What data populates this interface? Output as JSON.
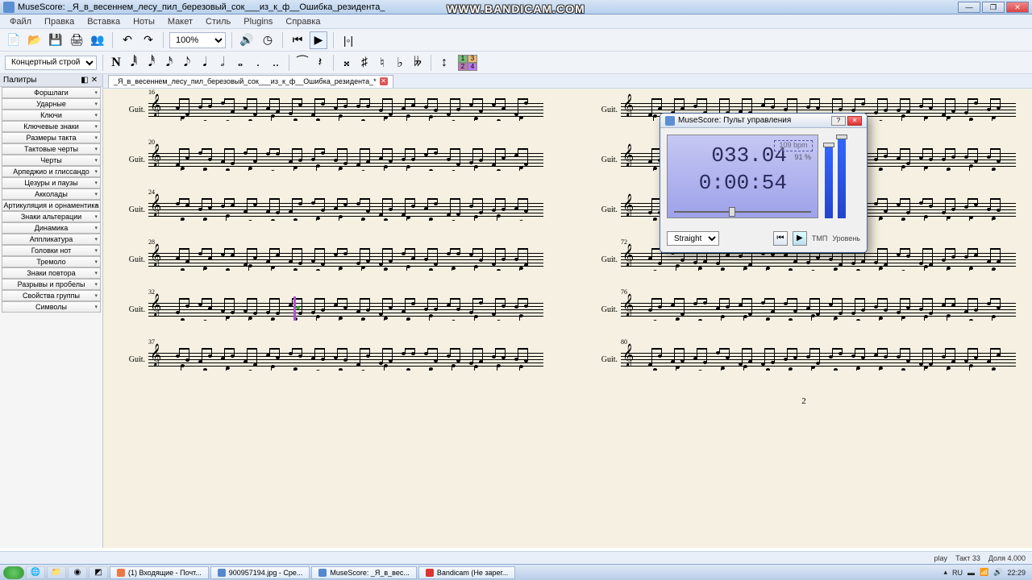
{
  "title_bar": {
    "app": "MuseScore",
    "doc": "_Я_в_весеннем_лесу_пил_березовый_сок___из_к_ф__Ошибка_резидента_"
  },
  "watermark": "WWW.BANDICAM.COM",
  "menu": [
    "Файл",
    "Правка",
    "Вставка",
    "Ноты",
    "Макет",
    "Стиль",
    "Plugins",
    "Справка"
  ],
  "zoom": "100%",
  "layout_selector": "Концертный строй",
  "voice_labels": [
    "1",
    "2",
    "3",
    "4"
  ],
  "palette": {
    "title": "Палитры",
    "items": [
      "Форшлаги",
      "Ударные",
      "Ключи",
      "Ключевые знаки",
      "Размеры такта",
      "Тактовые черты",
      "Черты",
      "Арпеджио и глиссандо",
      "Цезуры и паузы",
      "Акколады",
      "Артикуляция и орнаментика",
      "Знаки альтерации",
      "Динамика",
      "Аппликатура",
      "Головки нот",
      "Тремоло",
      "Знаки повтора",
      "Разрывы и пробелы",
      "Свойства группы",
      "Символы"
    ]
  },
  "tab": {
    "label": "_Я_в_весеннем_лесу_пил_березовый_сок___из_к_ф__Ошибка_резидента_*"
  },
  "score": {
    "instrument": "Guit.",
    "left_measures": [
      "16",
      "20",
      "24",
      "28",
      "32",
      "37"
    ],
    "right_measures": [
      "",
      "",
      "",
      "72",
      "76",
      "80"
    ],
    "page_num": "2"
  },
  "play_panel": {
    "title": "MuseScore: Пульт управления",
    "measure": "033.04",
    "time": "0:00:54",
    "bpm": "109 bpm",
    "pct": "91 %",
    "swing": "Straight",
    "tmp_label": "ТМП",
    "level_label": "Уровень"
  },
  "status": {
    "mode": "play",
    "takt": "Такт 33",
    "dolya": "Доля 4.000"
  },
  "taskbar": {
    "items": [
      {
        "label": "(1) Входящие - Почт...",
        "color": "#e74"
      },
      {
        "label": "900957194.jpg - Сре...",
        "color": "#58c"
      },
      {
        "label": "MuseScore: _Я_в_вес...",
        "color": "#58c"
      },
      {
        "label": "Bandicam (Не зарег...",
        "color": "#d33"
      }
    ],
    "lang": "RU",
    "time": "22:29"
  }
}
